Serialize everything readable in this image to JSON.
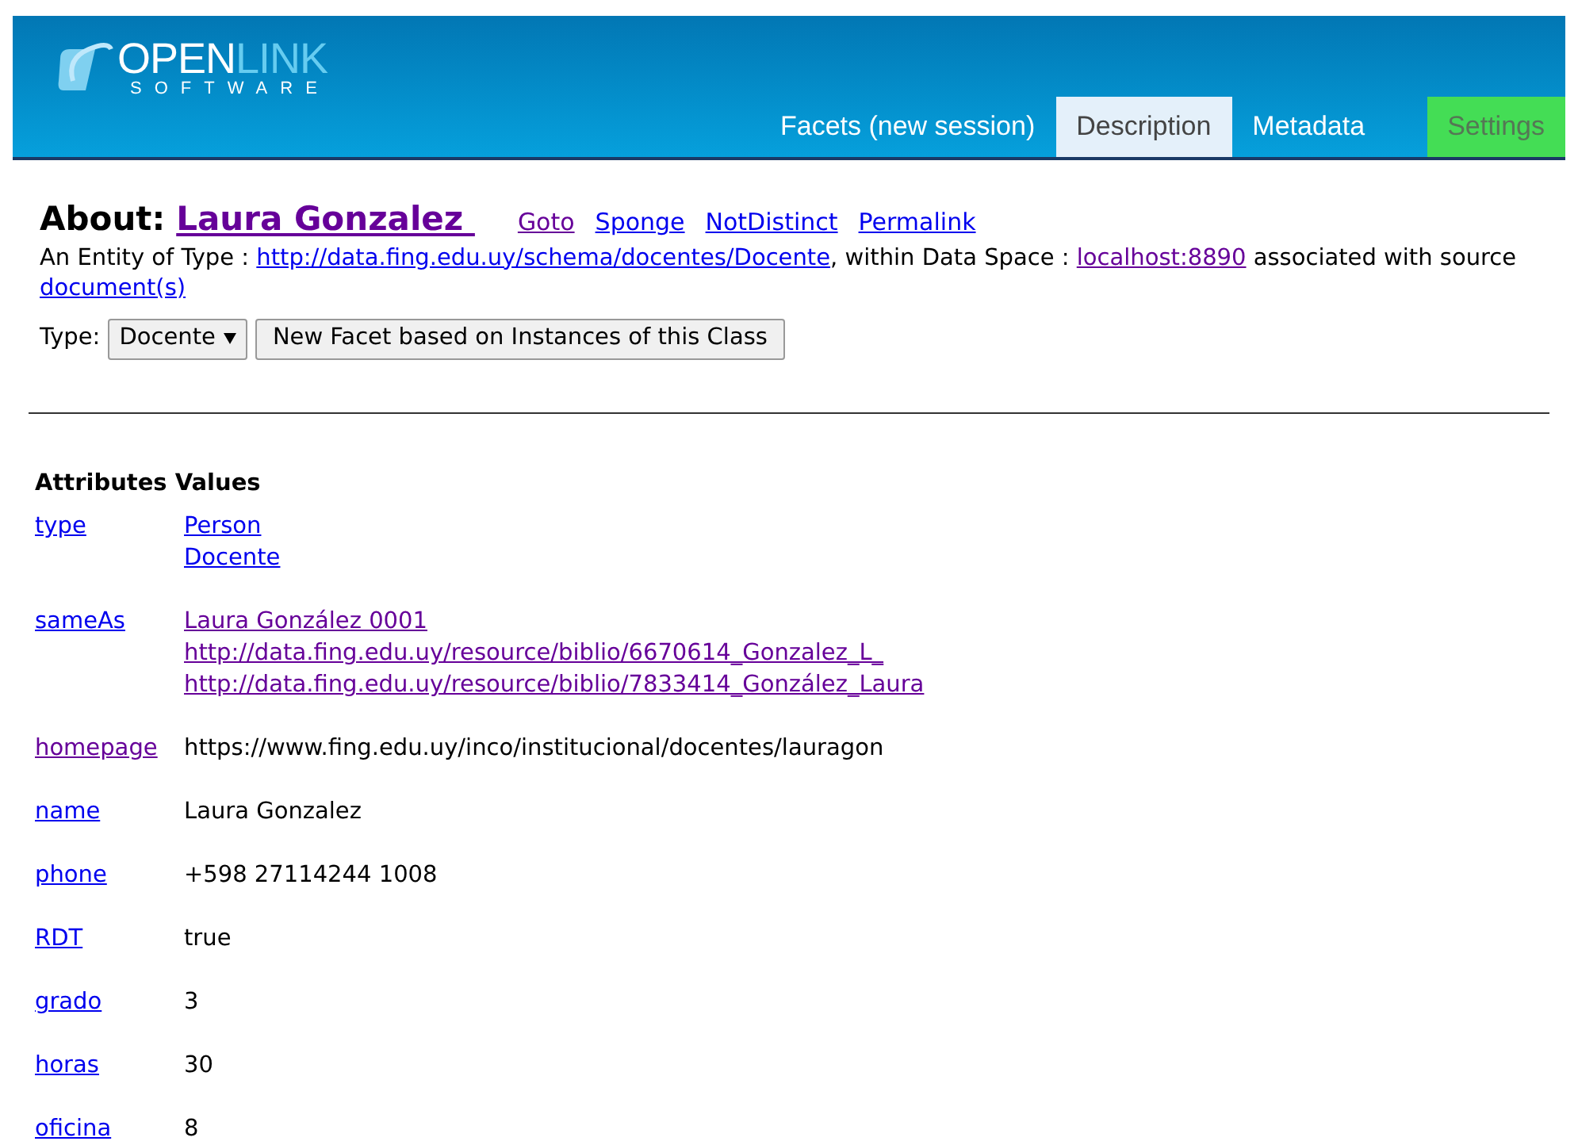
{
  "logo": {
    "word_a": "OPEN",
    "word_b": "LINK",
    "tagline": "SOFTWARE"
  },
  "tabs": [
    {
      "label": "Facets (new session)",
      "selected": false,
      "kind": "plain"
    },
    {
      "label": "Description",
      "selected": true,
      "kind": "plain"
    },
    {
      "label": "Metadata",
      "selected": false,
      "kind": "plain"
    },
    {
      "label": "Settings",
      "selected": false,
      "kind": "settings"
    }
  ],
  "about": {
    "label": "About:",
    "title": "Laura Gonzalez ",
    "links": [
      {
        "text": "Goto",
        "visited": true
      },
      {
        "text": "Sponge",
        "visited": false
      },
      {
        "text": "NotDistinct",
        "visited": false
      },
      {
        "text": "Permalink",
        "visited": false
      }
    ]
  },
  "entity_line": {
    "prefix": "An Entity of Type : ",
    "type_link": "http://data.fing.edu.uy/schema/docentes/Docente",
    "middle": ", within Data Space : ",
    "space_link": "localhost:8890",
    "suffix": " associated with source ",
    "source_link": "document(s)"
  },
  "type_row": {
    "label": "Type:",
    "select_value": "Docente",
    "button": "New Facet based on Instances of this Class"
  },
  "table": {
    "columns": [
      "Attributes",
      "Values"
    ],
    "rows": [
      {
        "attribute": "type",
        "visited": false,
        "values": [
          {
            "kind": "link",
            "text": "Person",
            "visited": false
          },
          {
            "kind": "link",
            "text": "Docente",
            "visited": false
          }
        ]
      },
      {
        "attribute": "sameAs",
        "visited": false,
        "values": [
          {
            "kind": "link",
            "text": "Laura González 0001",
            "visited": true
          },
          {
            "kind": "link",
            "text": "http://data.fing.edu.uy/resource/biblio/6670614_Gonzalez_L_",
            "visited": true
          },
          {
            "kind": "link",
            "text": "http://data.fing.edu.uy/resource/biblio/7833414_González_Laura",
            "visited": true
          }
        ]
      },
      {
        "attribute": "homepage",
        "visited": true,
        "values": [
          {
            "kind": "text",
            "text": "https://www.fing.edu.uy/inco/institucional/docentes/lauragon"
          }
        ]
      },
      {
        "attribute": "name",
        "visited": false,
        "values": [
          {
            "kind": "text",
            "text": "Laura Gonzalez"
          }
        ]
      },
      {
        "attribute": "phone",
        "visited": false,
        "values": [
          {
            "kind": "text",
            "text": "+598 27114244 1008"
          }
        ]
      },
      {
        "attribute": "RDT",
        "visited": false,
        "values": [
          {
            "kind": "text",
            "text": "true"
          }
        ]
      },
      {
        "attribute": "grado",
        "visited": false,
        "values": [
          {
            "kind": "text",
            "text": "3"
          }
        ]
      },
      {
        "attribute": "horas",
        "visited": false,
        "values": [
          {
            "kind": "text",
            "text": "30"
          }
        ]
      },
      {
        "attribute": "oficina",
        "visited": false,
        "values": [
          {
            "kind": "text",
            "text": "8"
          }
        ]
      }
    ]
  }
}
